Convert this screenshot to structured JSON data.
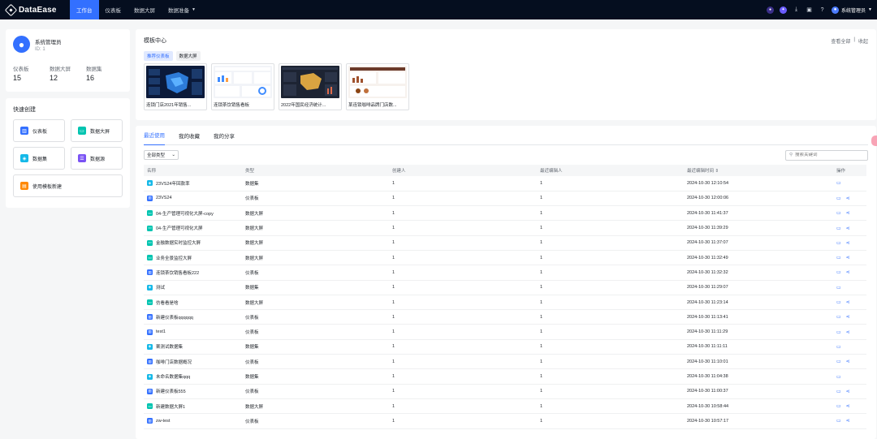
{
  "app": {
    "name": "DataEase"
  },
  "nav": [
    {
      "label": "工作台",
      "active": true
    },
    {
      "label": "仪表板"
    },
    {
      "label": "数据大屏"
    },
    {
      "label": "数据准备",
      "dropdown": true
    }
  ],
  "topbar": {
    "icons": [
      "copilot-icon",
      "ai-icon",
      "download-icon",
      "message-icon",
      "help-icon"
    ],
    "user_label": "系统管理员"
  },
  "profile": {
    "name": "系统管理员",
    "id_label": "ID: 1",
    "stats": [
      {
        "label": "仪表板",
        "value": "15"
      },
      {
        "label": "数据大屏",
        "value": "12"
      },
      {
        "label": "数据集",
        "value": "16"
      }
    ]
  },
  "quick_create": {
    "title": "快速创建",
    "items": [
      {
        "label": "仪表板",
        "color": "#3370ff"
      },
      {
        "label": "数据大屏",
        "color": "#00c4b0"
      },
      {
        "label": "数据集",
        "color": "#15b9e8"
      },
      {
        "label": "数据源",
        "color": "#7a52f4"
      },
      {
        "label": "使用模板新建",
        "color": "#ff8800"
      }
    ]
  },
  "template_center": {
    "title": "模板中心",
    "view_all": "查看全部",
    "collapse": "收起",
    "tabs": [
      "推荐仪表板",
      "数据大屏"
    ],
    "cards": [
      {
        "caption": "连锁门店2021年销售..."
      },
      {
        "caption": "连锁茶饮销售看板"
      },
      {
        "caption": "2022年国民经济统计..."
      },
      {
        "caption": "某连锁咖啡品牌门店数..."
      }
    ]
  },
  "list": {
    "tabs": [
      "最近使用",
      "我的收藏",
      "我的分享"
    ],
    "filter_value": "全部类型",
    "search_placeholder": "搜索关键词",
    "columns": [
      "名称",
      "类型",
      "创建人",
      "最近编辑人",
      "最近编辑时间 ⇕",
      "操作"
    ],
    "rows": [
      {
        "name": "23VS24年回款率",
        "type": "数据集",
        "creator": "1",
        "editor": "1",
        "time": "2024-10-30 12:10:54",
        "kind": "dataset",
        "share": false
      },
      {
        "name": "23VS24",
        "type": "仪表板",
        "creator": "1",
        "editor": "1",
        "time": "2024-10-30 12:00:06",
        "kind": "panel",
        "share": true
      },
      {
        "name": "04-生产管理可视化大屏-copy",
        "type": "数据大屏",
        "creator": "1",
        "editor": "1",
        "time": "2024-10-30 11:41:37",
        "kind": "screen",
        "share": true
      },
      {
        "name": "04-生产管理可视化大屏",
        "type": "数据大屏",
        "creator": "1",
        "editor": "1",
        "time": "2024-10-30 11:39:29",
        "kind": "screen",
        "share": true
      },
      {
        "name": "金融数据实时监控大屏",
        "type": "数据大屏",
        "creator": "1",
        "editor": "1",
        "time": "2024-10-30 11:37:07",
        "kind": "screen",
        "share": true
      },
      {
        "name": "业务全景监控大屏",
        "type": "数据大屏",
        "creator": "1",
        "editor": "1",
        "time": "2024-10-30 11:32:49",
        "kind": "screen",
        "share": true
      },
      {
        "name": "连锁茶饮销售看板222",
        "type": "仪表板",
        "creator": "1",
        "editor": "1",
        "time": "2024-10-30 11:32:32",
        "kind": "panel",
        "share": true
      },
      {
        "name": "测试",
        "type": "数据集",
        "creator": "1",
        "editor": "1",
        "time": "2024-10-30 11:29:07",
        "kind": "dataset",
        "share": false
      },
      {
        "name": "仿看看是啥",
        "type": "数据大屏",
        "creator": "1",
        "editor": "1",
        "time": "2024-10-30 11:23:14",
        "kind": "screen",
        "share": true
      },
      {
        "name": "新建仪表板qqqqqq",
        "type": "仪表板",
        "creator": "1",
        "editor": "1",
        "time": "2024-10-30 11:13:41",
        "kind": "panel",
        "share": true
      },
      {
        "name": "test1",
        "type": "仪表板",
        "creator": "1",
        "editor": "1",
        "time": "2024-10-30 11:11:29",
        "kind": "panel",
        "share": true
      },
      {
        "name": "案测试数据集",
        "type": "数据集",
        "creator": "1",
        "editor": "1",
        "time": "2024-10-30 11:11:11",
        "kind": "dataset",
        "share": false
      },
      {
        "name": "咖啡门店数据概况",
        "type": "仪表板",
        "creator": "1",
        "editor": "1",
        "time": "2024-10-30 11:10:01",
        "kind": "panel",
        "share": true
      },
      {
        "name": "未命名数据集qqq",
        "type": "数据集",
        "creator": "1",
        "editor": "1",
        "time": "2024-10-30 11:04:38",
        "kind": "dataset",
        "share": false
      },
      {
        "name": "新建仪表板555",
        "type": "仪表板",
        "creator": "1",
        "editor": "1",
        "time": "2024-10-30 11:00:37",
        "kind": "panel",
        "share": true
      },
      {
        "name": "新建数据大屏1",
        "type": "数据大屏",
        "creator": "1",
        "editor": "1",
        "time": "2024-10-30 10:58:44",
        "kind": "screen",
        "share": true
      },
      {
        "name": "zw-test",
        "type": "仪表板",
        "creator": "1",
        "editor": "1",
        "time": "2024-10-30 10:57:17",
        "kind": "panel",
        "share": true
      }
    ]
  },
  "colors": {
    "accent": "#3370ff",
    "topbar": "#050e1f",
    "panel": "#3370ff",
    "screen": "#00c4b0",
    "dataset": "#15b9e8"
  }
}
